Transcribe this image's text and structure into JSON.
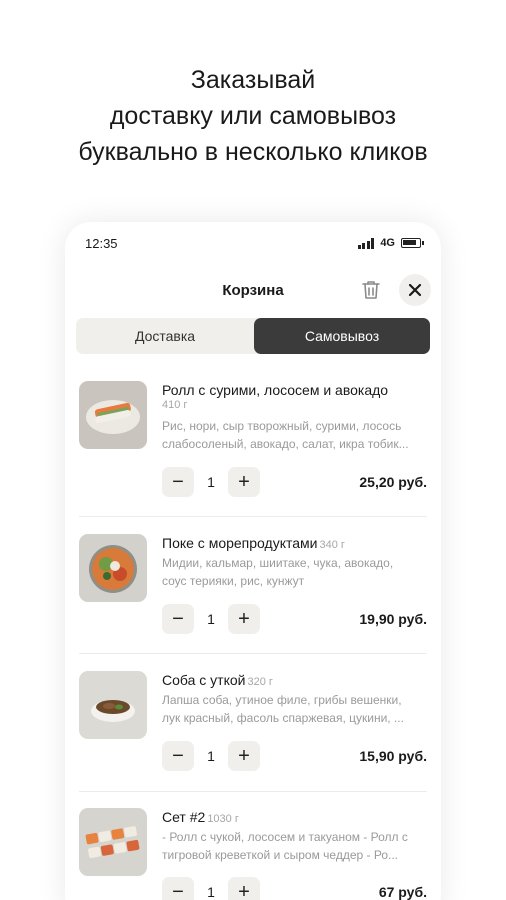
{
  "headline": {
    "line1": "Заказывай",
    "line2": "доставку или самовывоз",
    "line3": "буквально в несколько кликов"
  },
  "status_bar": {
    "time": "12:35",
    "network": "4G"
  },
  "header": {
    "title": "Корзина",
    "trash_icon": "trash-icon",
    "close_icon": "close-icon"
  },
  "tabs": {
    "delivery": "Доставка",
    "pickup": "Самовывоз",
    "selected": "pickup"
  },
  "cart_items": [
    {
      "name": "Ролл с сурими, лососем и авокадо",
      "weight": "410 г",
      "desc1": "Рис, нори, сыр творожный, сурими, лосось",
      "desc2": "слабосоленый, авокадо, салат, икра тобик...",
      "qty": "1",
      "price": "25,20 руб."
    },
    {
      "name": "Поке с морепродуктами",
      "weight": "340 г",
      "desc1": "Мидии, кальмар, шиитаке, чука, авокадо,",
      "desc2": "соус терияки, рис, кунжут",
      "qty": "1",
      "price": "19,90 руб."
    },
    {
      "name": "Соба с уткой",
      "weight": "320 г",
      "desc1": "Лапша соба, утиное филе, грибы вешенки,",
      "desc2": "лук красный, фасоль спаржевая, цукини, ...",
      "qty": "1",
      "price": "15,90 руб."
    },
    {
      "name": "Сет #2",
      "weight": "1030 г",
      "desc1": "- Ролл с чукой, лососем и такуаном - Ролл с",
      "desc2": "тигровой креветкой и сыром чеддер - Ро...",
      "qty": "1",
      "price": "67 руб."
    }
  ],
  "stepper": {
    "minus": "−",
    "plus": "+"
  }
}
